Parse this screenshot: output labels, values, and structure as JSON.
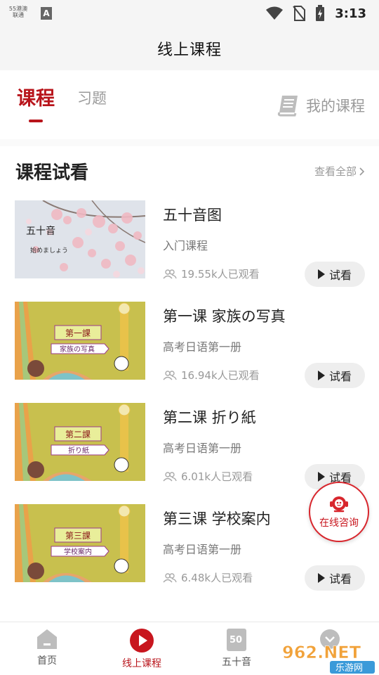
{
  "status_bar": {
    "carrier_text": "55港澳\n联通",
    "time": "3:13",
    "a_icon_label": "A"
  },
  "header": {
    "title": "线上课程"
  },
  "tabs": {
    "course": "课程",
    "exercise": "习题",
    "my_course": "我的课程"
  },
  "section": {
    "title": "课程试看",
    "view_all": "查看全部"
  },
  "courses": [
    {
      "name": "五十音图",
      "sub": "入门课程",
      "views": "19.55k人已观看",
      "button": "试看",
      "thumb_line1": "五十音",
      "thumb_line2": "始めましょう"
    },
    {
      "name": "第一课 家族の写真",
      "sub": "高考日语第一册",
      "views": "16.94k人已观看",
      "button": "试看",
      "thumb_line1": "第一課",
      "thumb_line2": "家族の写真"
    },
    {
      "name": "第二课 折り紙",
      "sub": "高考日语第一册",
      "views": "6.01k人已观看",
      "button": "试看",
      "thumb_line1": "第二課",
      "thumb_line2": "折り紙"
    },
    {
      "name": "第三课 学校案内",
      "sub": "高考日语第一册",
      "views": "6.48k人已观看",
      "button": "试看",
      "thumb_line1": "第三課",
      "thumb_line2": "学校案内"
    }
  ],
  "consult": {
    "label": "在线咨询"
  },
  "bottom_nav": {
    "home": "首页",
    "online_course": "线上课程",
    "fifty_sounds": "五十音",
    "fifty_icon_text": "50"
  },
  "watermark": {
    "main": "962.NET",
    "sub": "乐游网"
  },
  "colors": {
    "accent": "#b8141b",
    "thumb_bg": "#c8c04e",
    "consult_red": "#d8262d"
  }
}
